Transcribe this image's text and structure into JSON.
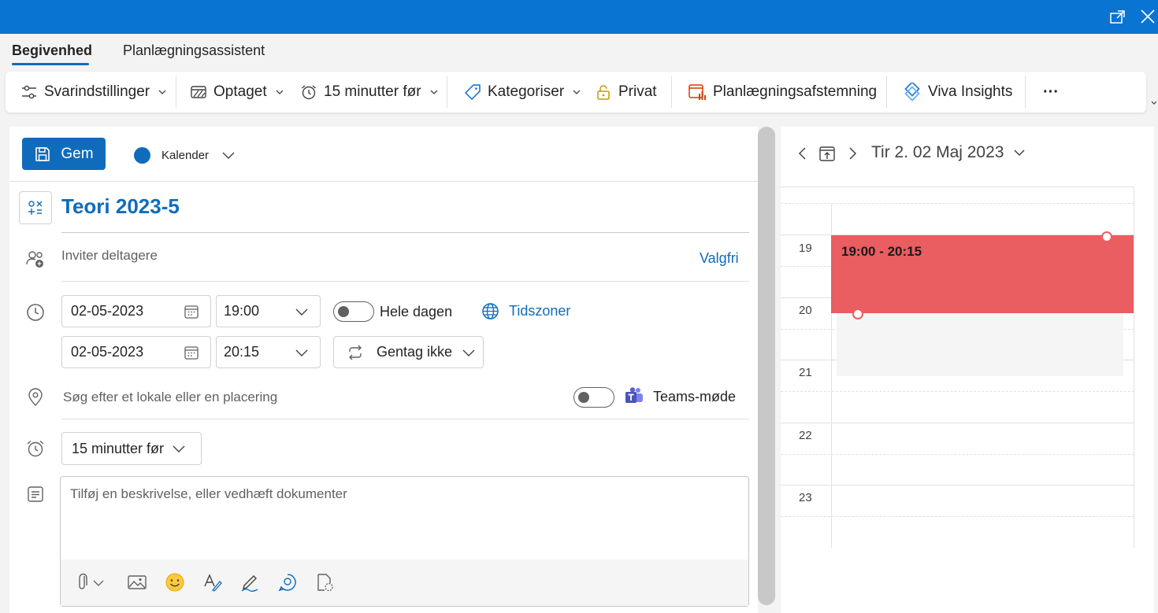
{
  "tabs": [
    {
      "label": "Begivenhed",
      "active": true
    },
    {
      "label": "Planlægningsassistent",
      "active": false
    }
  ],
  "ribbon": {
    "response_options": "Svarindstillinger",
    "show_as": "Optaget",
    "reminder": "15 minutter før",
    "categorize": "Kategoriser",
    "private": "Privat",
    "scheduling_poll": "Planlægningsafstemning",
    "viva_insights": "Viva Insights",
    "more": "···"
  },
  "form": {
    "save_label": "Gem",
    "calendar_label": "Kalender",
    "title": "Teori 2023-5",
    "invite_placeholder": "Inviter deltagere",
    "optional_link": "Valgfri",
    "start_date": "02-05-2023",
    "start_time": "19:00",
    "end_date": "02-05-2023",
    "end_time": "20:15",
    "all_day_label": "Hele dagen",
    "all_day_on": false,
    "timezones_link": "Tidszoner",
    "repeat": "Gentag ikke",
    "location_placeholder": "Søg efter et lokale eller en placering",
    "teams_label": "Teams-møde",
    "teams_on": false,
    "reminder": "15 minutter før",
    "description_placeholder": "Tilføj en beskrivelse, eller vedhæft dokumenter"
  },
  "day_view": {
    "date_label": "Tir 2. 02 Maj 2023",
    "hours": [
      "19",
      "20",
      "21",
      "22",
      "23"
    ],
    "event_time": "19:00 - 20:15"
  },
  "colors": {
    "titlebar": "#0a74d2",
    "accent": "#0f6cbd",
    "event": "#ea5d61",
    "viva": "#2b7cd3",
    "poll": "#d83b01",
    "teams": "#5b5fc7"
  },
  "icons": [
    "popout-icon",
    "close-icon",
    "response-options-icon",
    "show-as-icon",
    "alarm-icon",
    "tag-icon",
    "lock-icon",
    "poll-icon",
    "viva-insights-icon",
    "save-icon",
    "calendar-dot-icon",
    "title-icon",
    "people-add-icon",
    "clock-icon",
    "calendar-icon",
    "globe-icon",
    "repeat-icon",
    "location-icon",
    "teams-icon",
    "reminder-icon",
    "notes-icon",
    "attach-icon",
    "image-icon",
    "emoji-icon",
    "format-icon",
    "signature-icon",
    "loop-icon",
    "template-icon",
    "chevron-left-icon",
    "today-icon",
    "chevron-right-icon"
  ]
}
